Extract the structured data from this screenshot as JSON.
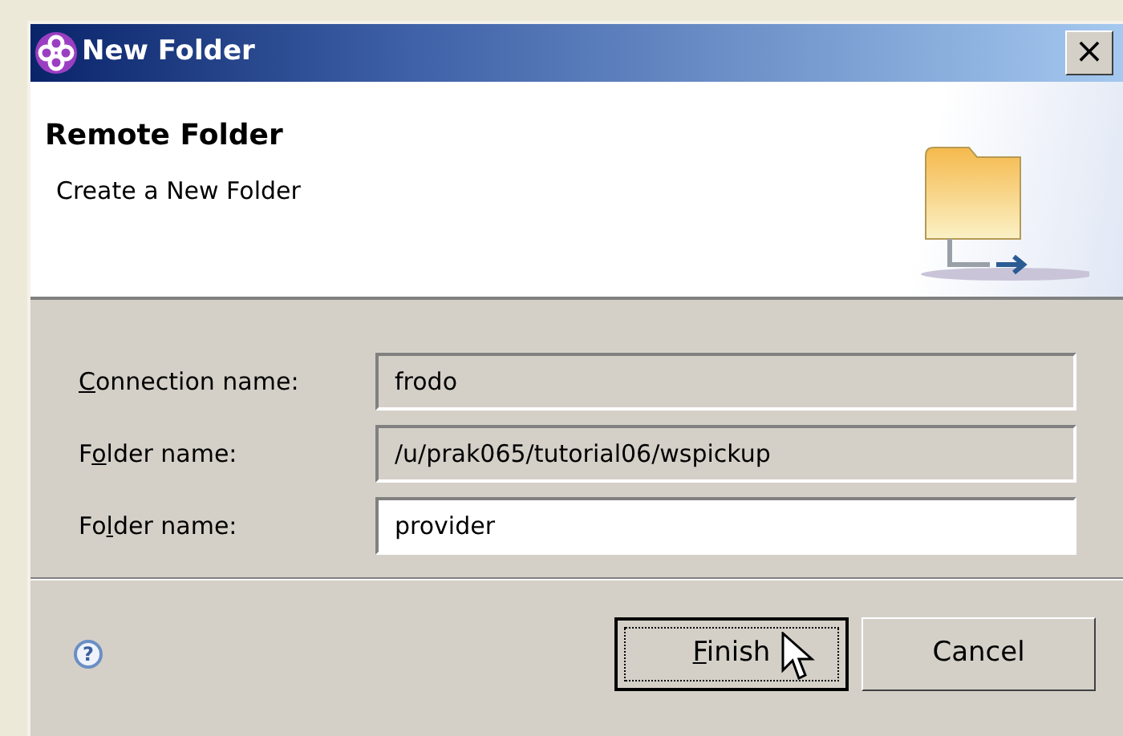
{
  "window": {
    "title": "New Folder",
    "close": "×"
  },
  "header": {
    "title": "Remote Folder",
    "subtitle": "Create a New Folder"
  },
  "fields": [
    {
      "label": {
        "key": "C",
        "after": "onnection name:"
      },
      "value": "frodo",
      "disabled": true
    },
    {
      "label": {
        "before": "F",
        "key": "o",
        "after": "lder name:"
      },
      "value": "/u/prak065/tutorial06/wspickup",
      "disabled": true
    },
    {
      "label": {
        "before": "Fo",
        "key": "l",
        "after": "der name:"
      },
      "value": "provider",
      "disabled": false
    }
  ],
  "help": "?",
  "buttons": [
    {
      "label": {
        "key": "F",
        "after": "inish"
      },
      "default": true,
      "focused": true
    },
    {
      "label": {
        "before": "Cancel"
      },
      "default": false,
      "focused": false
    }
  ]
}
